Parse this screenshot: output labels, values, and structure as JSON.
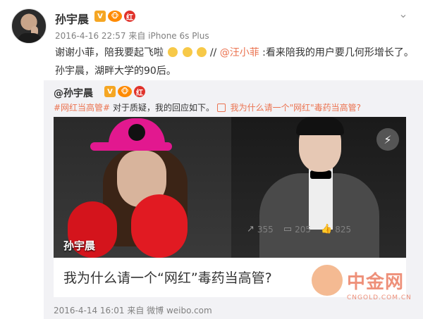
{
  "post": {
    "author": "孙宇晨",
    "badge_v": "V",
    "badge_vip": "🐵",
    "badge_red": "红",
    "timestamp": "2016-4-16 22:57",
    "source_prefix": "来自",
    "source": "iPhone 6s Plus",
    "text_line1_a": "谢谢小菲，陪我要起飞啦",
    "text_line1_b": "//",
    "text_line1_mention": "@汪小菲",
    "text_line1_c": ":看来陪我的用户要几何形增长了。",
    "text_line2": "孙宇晨，湖畔大学的90后。"
  },
  "repost": {
    "author": "@孙宇晨",
    "topic": "#网红当高管#",
    "text": " 对于质疑，我的回应如下。",
    "link_text": "我为什么请一个\"网红\"毒药当高管?",
    "card": {
      "overlay_name": "孙宇晨",
      "title": "我为什么请一个“网红”毒药当高管?"
    },
    "footer_time": "2016-4-14 16:01",
    "footer_source_prefix": "来自",
    "footer_source": "微博 weibo.com",
    "actions": {
      "repost_count": "355",
      "comment_count": "205",
      "like_count": "825"
    }
  },
  "watermark": {
    "title": "中金网",
    "subtitle": "CNGOLD.COM.CN"
  },
  "icons": {
    "chevron": "chevron-down-icon",
    "flash": "lightning-icon",
    "repost": "repost-icon",
    "comment": "comment-icon",
    "like": "thumbs-up-icon"
  }
}
